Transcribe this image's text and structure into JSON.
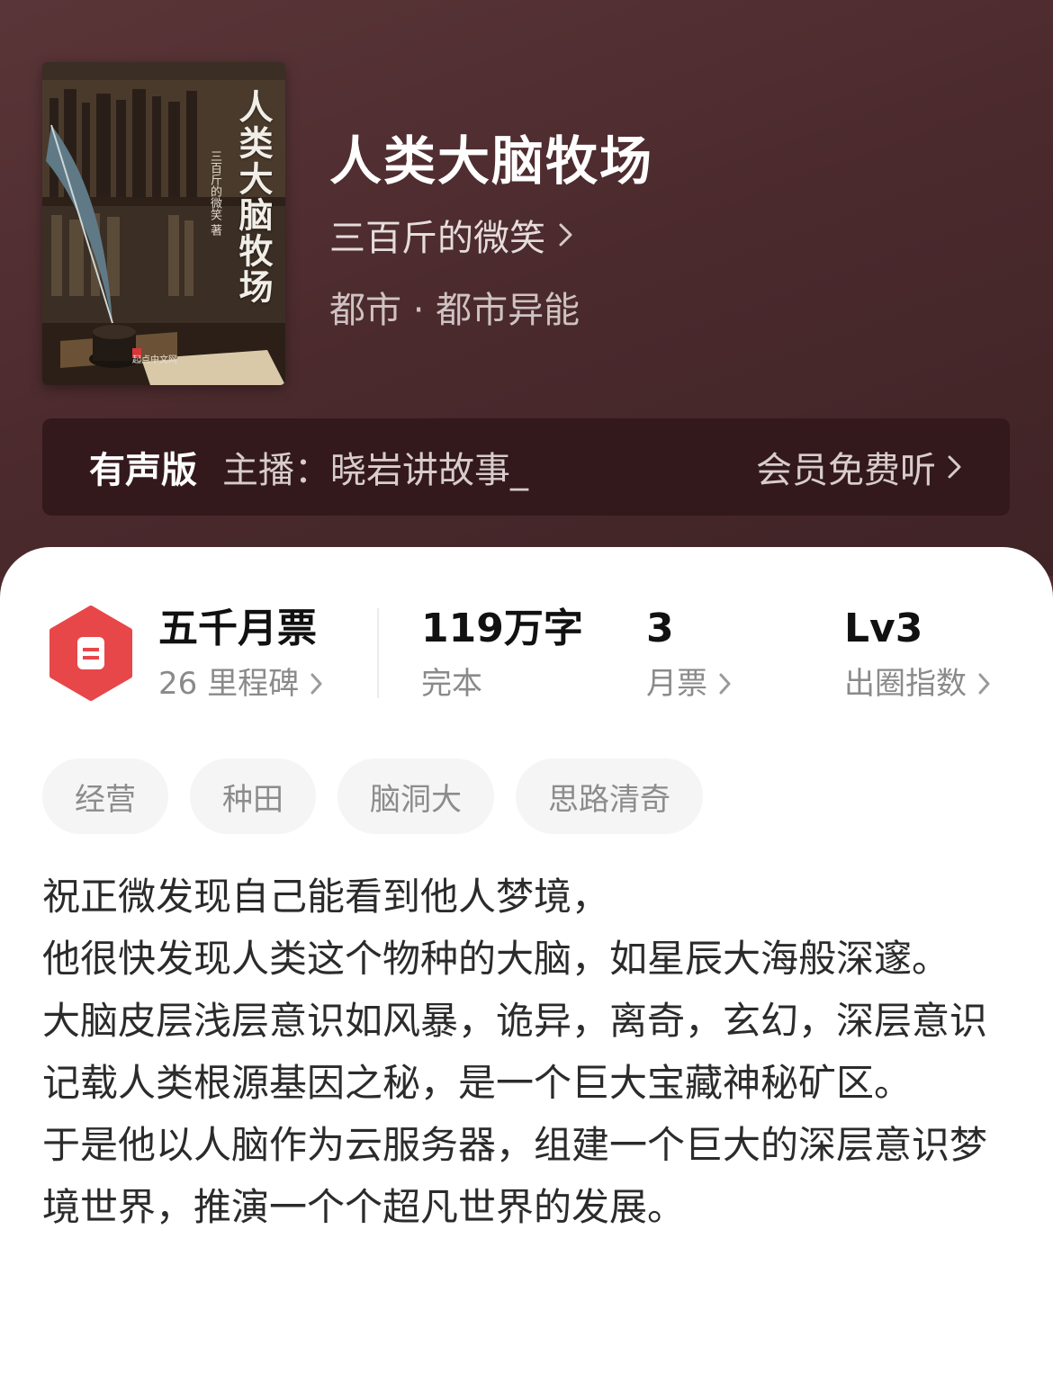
{
  "book": {
    "title": "人类大脑牧场",
    "author": "三百斤的微笑",
    "genre": "都市 · 都市异能",
    "cover": {
      "title": "人类大脑牧场",
      "author": "三百斤的微笑",
      "author_suffix": "著",
      "publisher": "起点中文网"
    }
  },
  "audio": {
    "label": "有声版",
    "host": "主播：晓岩讲故事_",
    "link": "会员免费听"
  },
  "stats": {
    "badge": {
      "main": "五千月票",
      "sub": "26 里程碑"
    },
    "words": {
      "main": "119万字",
      "sub": "完本"
    },
    "tickets": {
      "main": "3",
      "sub": "月票"
    },
    "index": {
      "main": "Lv3",
      "sub": "出圈指数"
    }
  },
  "tags": [
    "经营",
    "种田",
    "脑洞大",
    "思路清奇"
  ],
  "description": [
    "祝正微发现自己能看到他人梦境，",
    "他很快发现人类这个物种的大脑，如星辰大海般深邃。",
    "大脑皮层浅层意识如风暴，诡异，离奇，玄幻，深层意识记载人类根源基因之秘，是一个巨大宝藏神秘矿区。",
    "于是他以人脑作为云服务器，组建一个巨大的深层意识梦境世界，推演一个个超凡世界的发展。"
  ],
  "colors": {
    "hero_bg": "#4a2b2e",
    "audio_bar": "#33191c",
    "badge_red": "#e8474a",
    "tag_bg": "#f5f5f5"
  },
  "icons": [
    "chevron-right-icon",
    "ticket-badge-icon"
  ]
}
